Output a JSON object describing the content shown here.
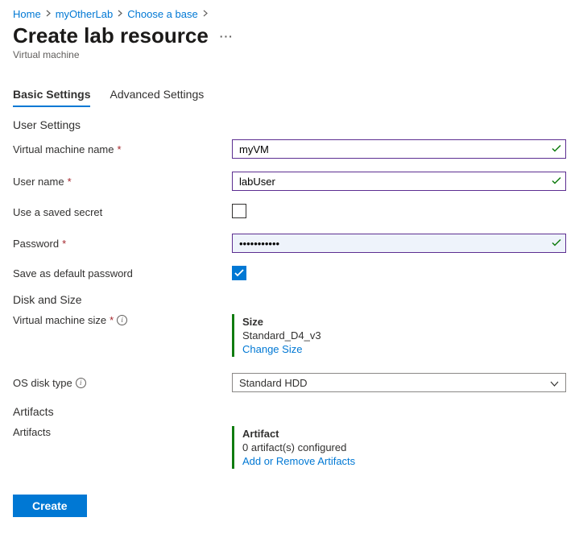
{
  "breadcrumb": {
    "items": [
      {
        "label": "Home"
      },
      {
        "label": "myOtherLab"
      },
      {
        "label": "Choose a base"
      }
    ]
  },
  "header": {
    "title": "Create lab resource",
    "subtitle": "Virtual machine"
  },
  "tabs": {
    "basic": "Basic Settings",
    "advanced": "Advanced Settings"
  },
  "sections": {
    "user_settings": "User Settings",
    "disk_and_size": "Disk and Size",
    "artifacts": "Artifacts"
  },
  "fields": {
    "vm_name": {
      "label": "Virtual machine name",
      "value": "myVM"
    },
    "user_name": {
      "label": "User name",
      "value": "labUser"
    },
    "use_saved_secret": {
      "label": "Use a saved secret",
      "checked": false
    },
    "password": {
      "label": "Password",
      "value": "•••••••••••"
    },
    "save_default_pw": {
      "label": "Save as default password",
      "checked": true
    },
    "vm_size": {
      "label": "Virtual machine size",
      "panel_title": "Size",
      "value": "Standard_D4_v3",
      "action": "Change Size"
    },
    "os_disk_type": {
      "label": "OS disk type",
      "value": "Standard HDD"
    },
    "artifacts": {
      "label": "Artifacts",
      "panel_title": "Artifact",
      "value": "0 artifact(s) configured",
      "action": "Add or Remove Artifacts"
    }
  },
  "actions": {
    "create": "Create"
  },
  "required_marker": "*"
}
